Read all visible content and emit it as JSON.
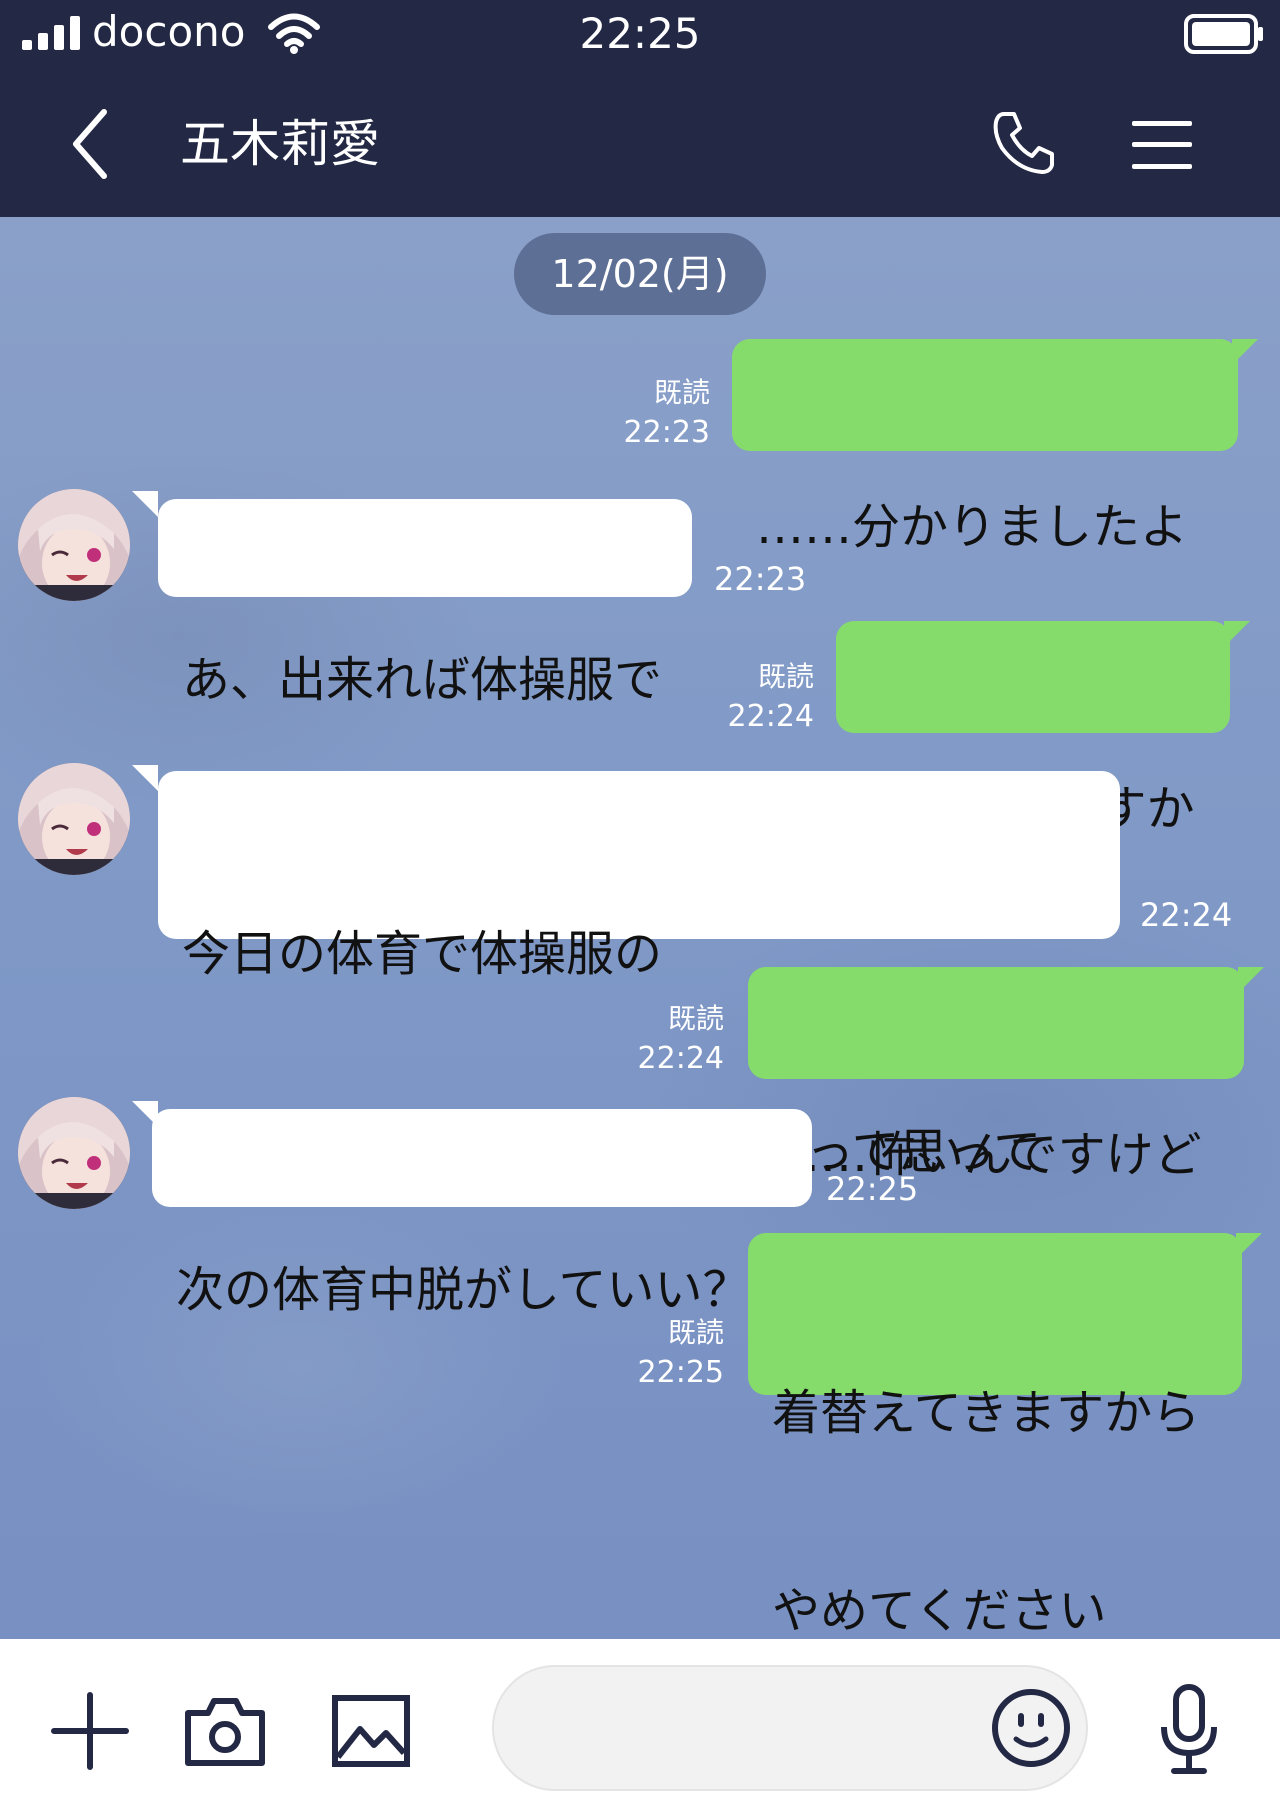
{
  "status_bar": {
    "carrier": "docono",
    "time": "22:25"
  },
  "header": {
    "contact_name": "五木莉愛"
  },
  "chat": {
    "date_label": "12/02(月)",
    "read_label": "既読",
    "messages": [
      {
        "from": "me",
        "lines": [
          "……分かりましたよ"
        ],
        "time": "22:23",
        "read": true
      },
      {
        "from": "them",
        "lines": [
          "あ、出来れば体操服で"
        ],
        "time": "22:23"
      },
      {
        "from": "me",
        "lines": [
          "どうしてですか"
        ],
        "time": "22:24",
        "read": true
      },
      {
        "from": "them",
        "lines": [
          "今日の体育で体操服の",
          "会長見てたら脱がしたいなーって思って"
        ],
        "time": "22:24"
      },
      {
        "from": "me",
        "lines": [
          "……怖いんですけど"
        ],
        "time": "22:24",
        "read": true
      },
      {
        "from": "them",
        "lines": [
          "次の体育中脱がしていい？"
        ],
        "time": "22:25"
      },
      {
        "from": "me",
        "lines": [
          "着替えてきますから",
          "やめてください"
        ],
        "time": "22:25",
        "read": true
      }
    ]
  },
  "colors": {
    "header_bg": "#232844",
    "chat_bg": "#7e97c2",
    "my_bubble": "#86dc6a",
    "their_bubble": "#ffffff",
    "icon_dark": "#232844"
  },
  "icons": [
    "signal-icon",
    "wifi-icon",
    "battery-icon",
    "back-arrow-icon",
    "phone-icon",
    "menu-icon",
    "plus-icon",
    "camera-icon",
    "image-icon",
    "emoji-icon",
    "microphone-icon"
  ]
}
